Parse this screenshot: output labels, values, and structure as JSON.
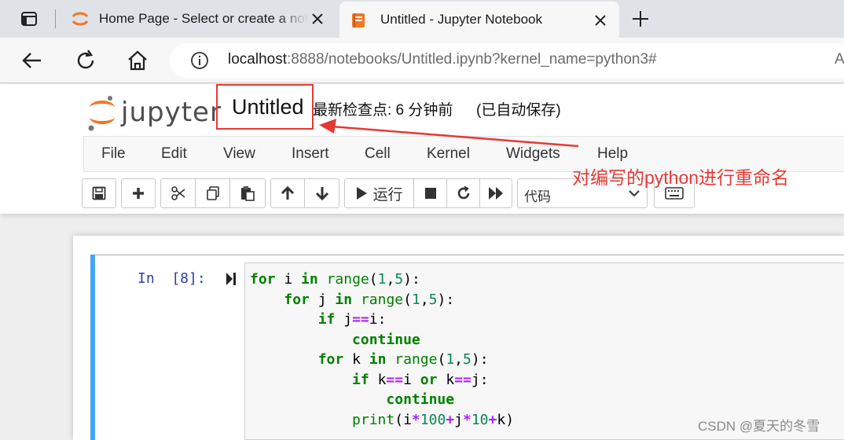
{
  "browser": {
    "tabs": [
      {
        "title": "Home Page - Select or create a notebook",
        "active": false
      },
      {
        "title": "Untitled - Jupyter Notebook",
        "active": true
      }
    ],
    "url_host": "localhost",
    "url_path": ":8888/notebooks/Untitled.ipynb?kernel_name=python3#",
    "url_extra": "A"
  },
  "jupyter": {
    "logo_text": "jupyter",
    "notebook_title": "Untitled",
    "checkpoint_text": "最新检查点: 6 分钟前",
    "autosave_text": "(已自动保存)",
    "menu": [
      "File",
      "Edit",
      "View",
      "Insert",
      "Cell",
      "Kernel",
      "Widgets",
      "Help"
    ],
    "toolbar": {
      "run_label": "运行",
      "cell_type": "代码"
    }
  },
  "annotation": {
    "text": "对编写的python进行重命名",
    "color": "#e53935"
  },
  "cell": {
    "prompt": "In  [8]:",
    "code_lines": [
      "for i in range(1,5):",
      "    for j in range(1,5):",
      "        if j==i:",
      "            continue",
      "        for k in range(1,5):",
      "            if k==i or k==j:",
      "                continue",
      "            print(i*100+j*10+k)"
    ]
  },
  "watermark": "CSDN @夏天的冬雪",
  "icons": [
    "tab-actions-icon",
    "jupyter-favicon-icon",
    "close-icon",
    "plus-icon",
    "back-arrow-icon",
    "reload-icon",
    "home-icon",
    "info-icon",
    "save-icon",
    "add-cell-icon",
    "cut-icon",
    "copy-icon",
    "paste-icon",
    "move-up-icon",
    "move-down-icon",
    "run-icon",
    "stop-icon",
    "restart-icon",
    "fast-forward-icon",
    "chevron-down-icon",
    "keyboard-icon"
  ]
}
